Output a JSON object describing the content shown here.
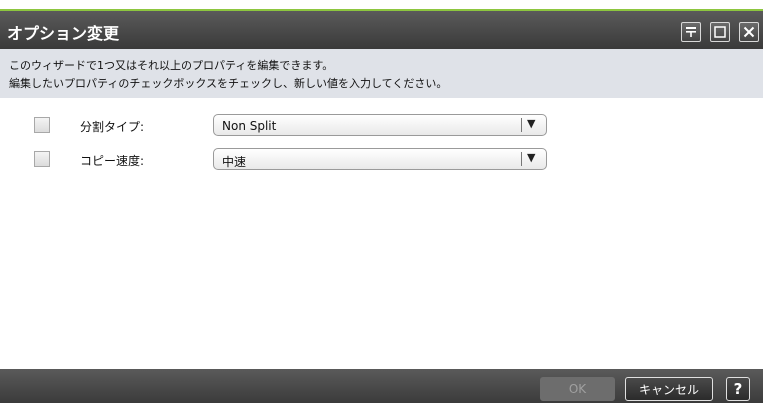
{
  "dialog": {
    "title": "オプション変更",
    "window_buttons": [
      {
        "name": "pin-icon",
        "glyph": "⊤"
      },
      {
        "name": "maximize-icon",
        "glyph": "☐"
      },
      {
        "name": "close-icon",
        "glyph": "✕"
      }
    ]
  },
  "instructions": {
    "line1": "このウィザードで1つ又はそれ以上のプロパティを編集できます。",
    "line2": "編集したいプロパティのチェックボックスをチェックし、新しい値を入力してください。"
  },
  "fields": [
    {
      "label": "分割タイプ:",
      "value": "Non Split",
      "checked": false,
      "arrow": "▼"
    },
    {
      "label": "コピー速度:",
      "value": "中速",
      "checked": false,
      "arrow": "▼"
    }
  ],
  "footer": {
    "ok_label": "OK",
    "cancel_label": "キャンセル",
    "help_label": "?"
  },
  "colors": {
    "accent": "#8dc63f",
    "titlebar": "#4a4a4a",
    "instructions_bg": "#dfe2e8"
  }
}
